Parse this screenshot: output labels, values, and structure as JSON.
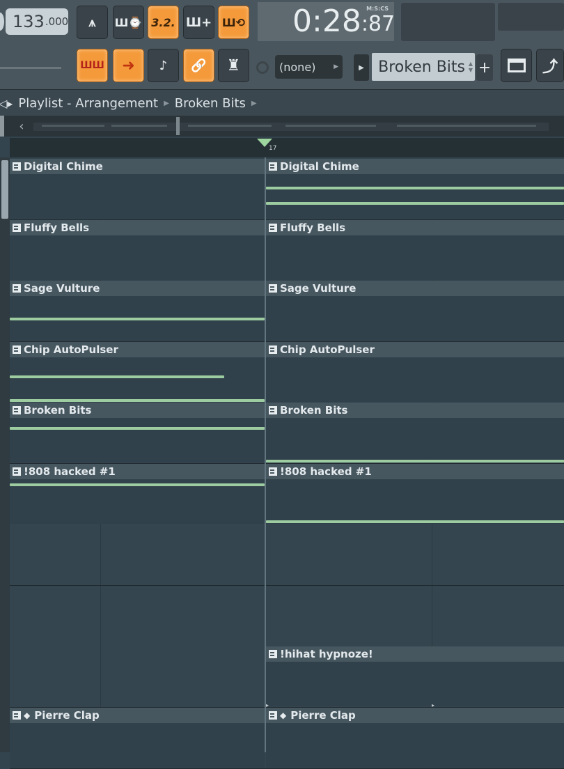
{
  "toolbar": {
    "tempo_main": "133",
    "tempo_decimal": ".000",
    "time_main": "0:28",
    "time_cs": ":87",
    "time_label": "M:S:CS",
    "btn_metronome": "⩚",
    "btn_wait": "Ш⌚",
    "btn_blend": "3.2.",
    "btn_step": "Ш+",
    "btn_loop": "Ш⟲",
    "btn_piano": "ШШ",
    "btn_arrow": "➜",
    "btn_slide": "♪",
    "btn_link": "🔗",
    "btn_stamp": "♜",
    "none_label": "(none)",
    "pattern_name": "Broken Bits",
    "add_label": "+"
  },
  "colors": {
    "accent": "#f49a3b",
    "note": "#9ccc9f",
    "lane": "#35454f"
  },
  "playlist": {
    "title": "Playlist - Arrangement",
    "pattern": "Broken Bits",
    "bar_number": "17"
  },
  "tracks": [
    {
      "left": "Digital Chime",
      "right": "Digital Chime"
    },
    {
      "left": "Fluffy Bells",
      "right": "Fluffy Bells"
    },
    {
      "left": "Sage Vulture",
      "right": "Sage Vulture"
    },
    {
      "left": "Chip AutoPulser",
      "right": "Chip AutoPulser"
    },
    {
      "left": "Broken Bits",
      "right": "Broken Bits"
    },
    {
      "left": "!808 hacked #1",
      "right": "!808 hacked #1"
    },
    {
      "left": "",
      "right": ""
    },
    {
      "left": "",
      "right": ""
    },
    {
      "left": "",
      "right": "!hihat hypnoze!"
    },
    {
      "left": "Pierre Clap",
      "right": "Pierre Clap"
    }
  ]
}
